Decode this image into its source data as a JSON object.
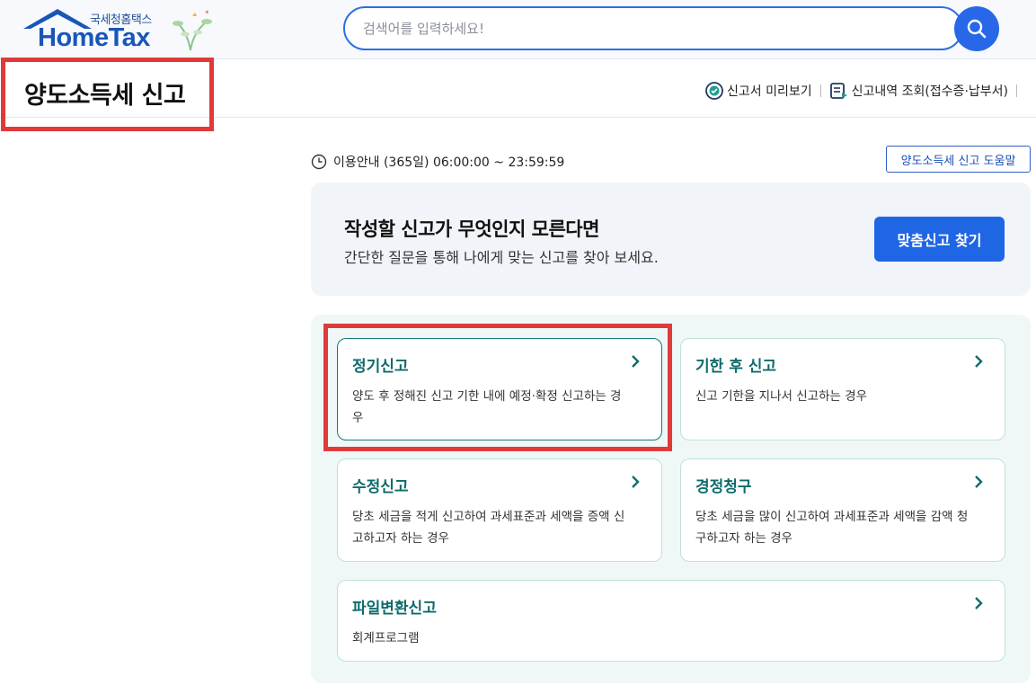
{
  "header": {
    "logo_small": "국세청홈택스",
    "logo_big": "HomeTax",
    "search_placeholder": "검색어를 입력하세요!"
  },
  "page": {
    "title": "양도소득세 신고",
    "links": [
      {
        "label": "신고서 미리보기",
        "icon": "eye-check-icon"
      },
      {
        "label": "신고내역 조회(접수증·납부서)",
        "icon": "document-list-icon"
      }
    ]
  },
  "notice": {
    "text": "이용안내 (365일) 06:00:00 ~ 23:59:59",
    "help_label": "양도소득세 신고 도움말"
  },
  "banner": {
    "heading": "작성할 신고가 무엇인지 모른다면",
    "text": "간단한 질문을 통해 나에게 맞는 신고를 찾아 보세요.",
    "button": "맞춤신고 찾기"
  },
  "cards": [
    {
      "title": "정기신고",
      "desc": "양도 후 정해진 신고 기한 내에 예정·확정 신고하는 경우"
    },
    {
      "title": "기한 후 신고",
      "desc": "신고 기한을 지나서 신고하는 경우"
    },
    {
      "title": "수정신고",
      "desc": "당초 세금을 적게 신고하여 과세표준과 세액을 증액 신고하고자 하는 경우"
    },
    {
      "title": "경정청구",
      "desc": "당초 세금을 많이 신고하여 과세표준과 세액을 감액 청구하고자 하는 경우"
    },
    {
      "title": "파일변환신고",
      "desc": "회계프로그램"
    }
  ],
  "colors": {
    "accent": "#1f66e5",
    "card_title": "#0f6b6b",
    "highlight": "#e03a3a"
  }
}
